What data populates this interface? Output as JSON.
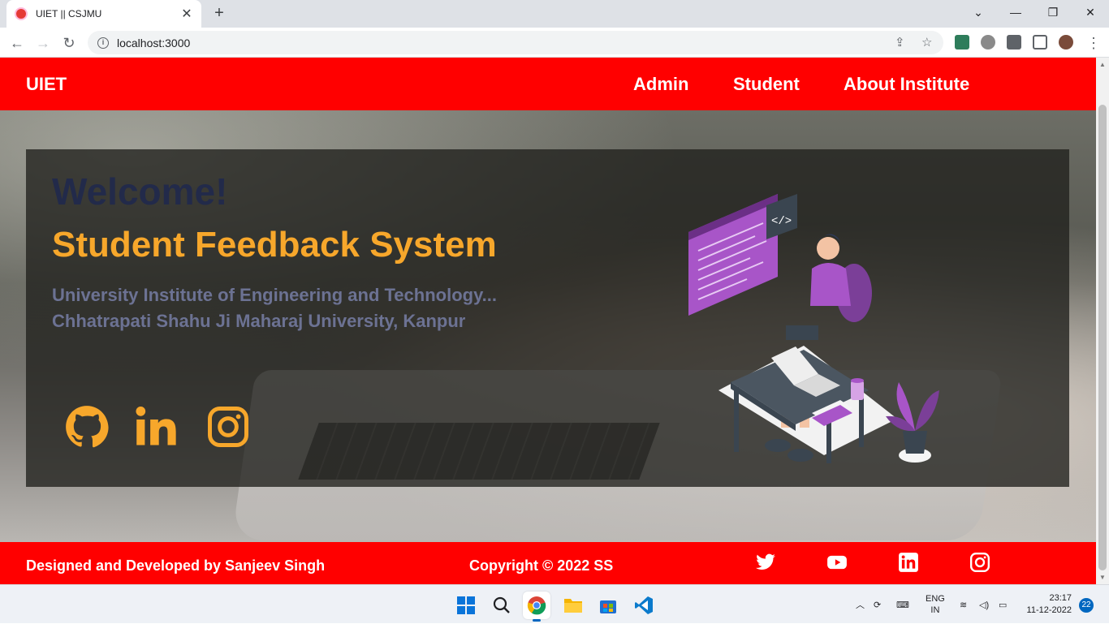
{
  "browser": {
    "tab_title": "UIET || CSJMU",
    "tab_close": "✕",
    "new_tab": "+",
    "url": "localhost:3000",
    "accent": "#dee1e6"
  },
  "navbar": {
    "brand": "UIET",
    "links": [
      "Admin",
      "Student",
      "About Institute"
    ],
    "color": "#ff0000"
  },
  "hero": {
    "welcome": "Welcome!",
    "headline": "Student Feedback System",
    "subtitle_line1": "University Institute of Engineering and Technology...",
    "subtitle_line2": "Chhatrapati Shahu Ji Maharaj University, Kanpur",
    "headline_color": "#f7a72b",
    "social_icons": [
      "github-icon",
      "linkedin-icon",
      "instagram-icon"
    ],
    "illustration": "developer-at-desk-illustration"
  },
  "footer": {
    "credit": "Designed and Developed by Sanjeev Singh",
    "copyright": "Copyright © 2022 SS",
    "icons": [
      "twitter-icon",
      "youtube-icon",
      "linkedin-icon",
      "instagram-icon"
    ]
  },
  "taskbar": {
    "language_line1": "ENG",
    "language_line2": "IN",
    "time": "23:17",
    "date": "11-12-2022",
    "notifications": "22",
    "apps": [
      "windows-start-icon",
      "search-icon",
      "chrome-icon",
      "file-explorer-icon",
      "store-icon",
      "vscode-icon"
    ]
  }
}
